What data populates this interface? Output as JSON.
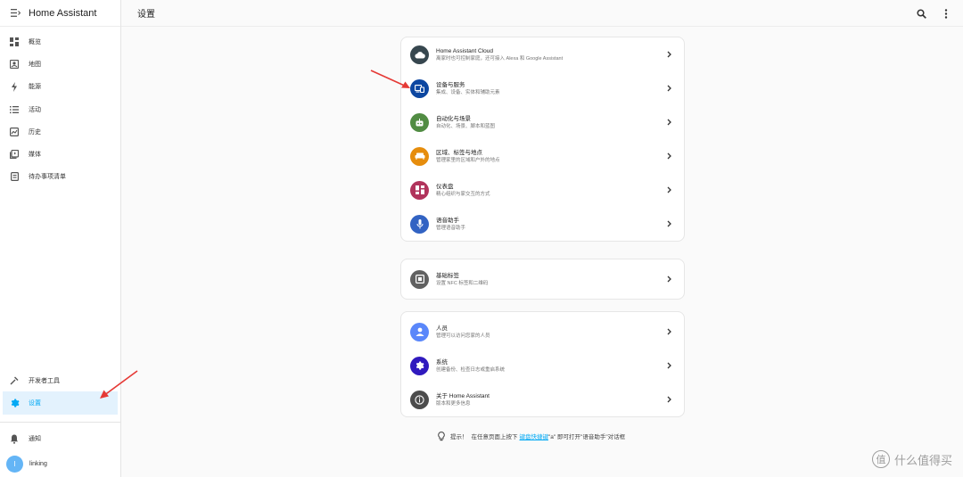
{
  "app": {
    "title": "Home Assistant"
  },
  "header": {
    "title": "设置"
  },
  "sidebar": {
    "items": [
      {
        "label": "概览",
        "icon": "overview-icon"
      },
      {
        "label": "地图",
        "icon": "map-icon"
      },
      {
        "label": "能源",
        "icon": "energy-icon"
      },
      {
        "label": "活动",
        "icon": "logbook-icon"
      },
      {
        "label": "历史",
        "icon": "history-icon"
      },
      {
        "label": "媒体",
        "icon": "media-icon"
      },
      {
        "label": "待办事项清单",
        "icon": "todo-icon"
      }
    ],
    "bottom": [
      {
        "label": "开发者工具",
        "icon": "hammer-icon"
      },
      {
        "label": "设置",
        "icon": "gear-icon",
        "active": true
      }
    ],
    "notifications": "通知",
    "user": {
      "name": "linking",
      "initial": "l"
    }
  },
  "cards": [
    {
      "rows": [
        {
          "title": "Home Assistant Cloud",
          "subtitle": "离家时也可控制家庭，还可接入 Alexa 和 Google Assistant",
          "color": "#37474f",
          "icon": "cloud-icon"
        },
        {
          "title": "设备与服务",
          "subtitle": "集成、设备、实体和辅助元素",
          "color": "#0d47a1",
          "icon": "devices-icon"
        },
        {
          "title": "自动化与场景",
          "subtitle": "自动化、场景、脚本和蓝图",
          "color": "#518c43",
          "icon": "robot-icon"
        },
        {
          "title": "区域、标签与地点",
          "subtitle": "管理家里的区域和户外的地点",
          "color": "#e68d0d",
          "icon": "sofa-icon"
        },
        {
          "title": "仪表盘",
          "subtitle": "精心组织与家交互的方式",
          "color": "#b1345c",
          "icon": "dashboard-icon"
        },
        {
          "title": "语音助手",
          "subtitle": "管理语音助手",
          "color": "#3263c3",
          "icon": "microphone-icon"
        }
      ]
    },
    {
      "rows": [
        {
          "title": "基础标签",
          "subtitle": "设置 NFC 标签和二维码",
          "color": "#616161",
          "icon": "nfc-icon"
        }
      ]
    },
    {
      "rows": [
        {
          "title": "人员",
          "subtitle": "管理可以访问您家的人员",
          "color": "#5a87fa",
          "icon": "account-icon"
        },
        {
          "title": "系统",
          "subtitle": "创建备份、检查日志或重启系统",
          "color": "#301abe",
          "icon": "cog-icon"
        },
        {
          "title": "关于 Home Assistant",
          "subtitle": "版本和更多信息",
          "color": "#4c4c4c",
          "icon": "info-icon"
        }
      ]
    }
  ],
  "tip": {
    "prefix": "提示！",
    "text1": "在任意页面上按下",
    "link": "键盘快捷键",
    "text2": "\"a\" 即可打开\"语音助手\"对话框"
  },
  "watermark": {
    "text": "什么值得买",
    "glyph": "值"
  },
  "colors": {
    "accent": "#03a9f4",
    "arrow": "#e53935"
  }
}
